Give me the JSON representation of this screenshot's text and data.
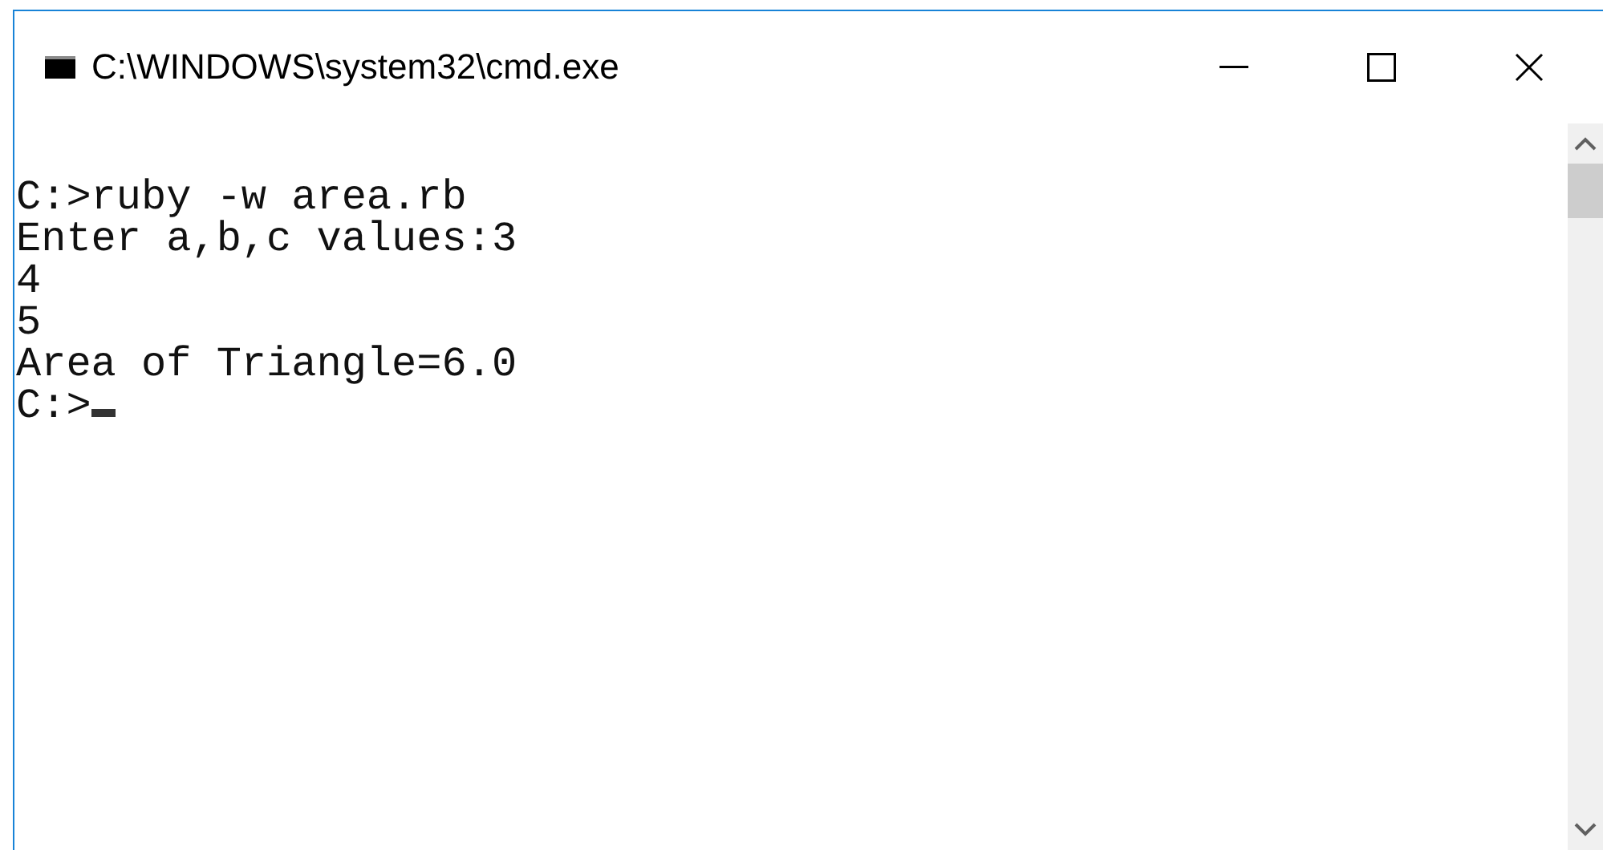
{
  "window": {
    "title": "C:\\WINDOWS\\system32\\cmd.exe"
  },
  "console": {
    "lines": [
      "C:>ruby -w area.rb",
      "Enter a,b,c values:3",
      "4",
      "5",
      "Area of Triangle=6.0",
      "C:>"
    ]
  }
}
